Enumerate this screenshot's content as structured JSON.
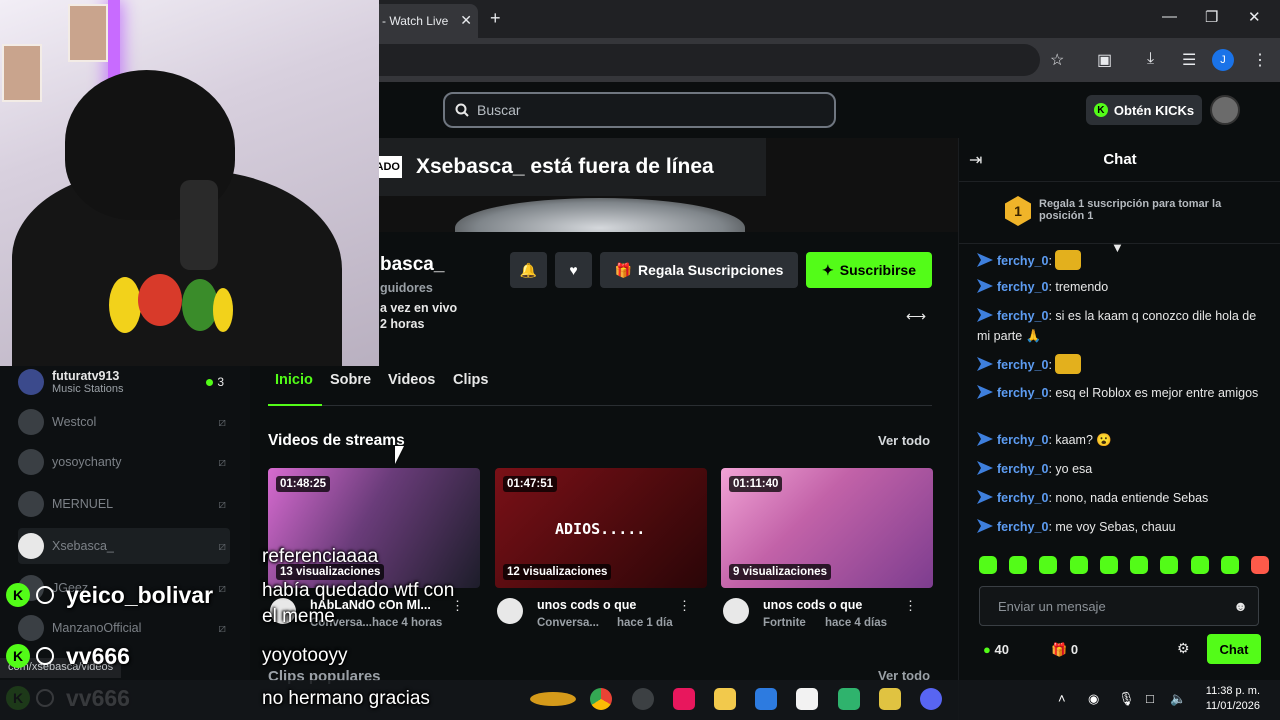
{
  "browser": {
    "tab_title": " - Watch Live",
    "tab_close": "✕",
    "new_tab": "+",
    "profile_initial": "J"
  },
  "topnav": {
    "search_placeholder": "Buscar",
    "kicks_button": "Obtén KICKs"
  },
  "sidebar": {
    "items": [
      {
        "name": "futuratv913",
        "sub": "Music Stations",
        "viewers": "3",
        "live": true
      },
      {
        "name": "Westcol"
      },
      {
        "name": "yosoychanty"
      },
      {
        "name": "MERNUEL"
      },
      {
        "name": "Xsebasca_"
      },
      {
        "name": "JGeez"
      },
      {
        "name": "ManzanoOfficial"
      }
    ]
  },
  "channel": {
    "offline_tag": "ADO",
    "offline_title": "Xsebasca_ está fuera de línea",
    "name": "basca_",
    "followers": "guidores",
    "last_live_line1": "a vez en vivo",
    "last_live_line2": "2 horas",
    "gift_subs": "Regala Suscripciones",
    "subscribe": "Suscribirse"
  },
  "tabs": [
    "Inicio",
    "Sobre",
    "Videos",
    "Clips"
  ],
  "videos": {
    "title": "Videos de streams",
    "see_all": "Ver todo",
    "items": [
      {
        "duration": "01:48:25",
        "views": "13 visualizaciones",
        "title": "hAbLaNdO cOn Ml...",
        "category": "Conversa...",
        "age": "hace 4 horas",
        "thumb": "#5b3f6e"
      },
      {
        "duration": "01:47:51",
        "views": "12 visualizaciones",
        "title": "unos cods o que",
        "category": "Conversa...",
        "age": "hace 1 día",
        "thumb": "#6e0f14",
        "overlay_text": "ADIOS....."
      },
      {
        "duration": "01:11:40",
        "views": "9 visualizaciones",
        "title": "unos cods o que",
        "category": "Fortnite",
        "age": "hace 4 días",
        "thumb": "#c262a8"
      }
    ]
  },
  "clips": {
    "title": "Clips populares",
    "see_all": "Ver todo"
  },
  "status_url": "com/xsebasca/videos",
  "chat": {
    "title": "Chat",
    "gift_rank": "1",
    "gift_prompt": "Regala 1 suscripción para tomar la posición 1",
    "messages": [
      {
        "user": "ferchy_0",
        "text": "",
        "emote": true
      },
      {
        "user": "ferchy_0",
        "text": "tremendo"
      },
      {
        "user": "ferchy_0",
        "text": "si es la kaam q conozco dile hola de mi parte 🙏"
      },
      {
        "user": "ferchy_0",
        "text": "",
        "emote": true
      },
      {
        "user": "ferchy_0",
        "text": "esq el Roblox es mejor entre amigos"
      },
      {
        "user": "ferchy_0",
        "text": "kaam? 😮"
      },
      {
        "user": "ferchy_0",
        "text": "yo esa"
      },
      {
        "user": "ferchy_0",
        "text": "nono, nada entiende Sebas"
      },
      {
        "user": "ferchy_0",
        "text": "me voy Sebas, chauu"
      }
    ],
    "input_placeholder": "Enviar un mensaje",
    "kicks_balance": "40",
    "gift_balance": "0",
    "send_button": "Chat"
  },
  "overlay": {
    "chat_lines": [
      {
        "user": "yeico_bolivar"
      },
      {
        "user": "vv666"
      },
      {
        "user": "vv666"
      }
    ],
    "subtitles": [
      "referenciaaaa",
      "había quedado wtf con",
      "el meme",
      "yoyotooyy",
      "no hermano gracias"
    ]
  },
  "taskbar": {
    "time": "11:38 p. m.",
    "date": "11/01/2026"
  },
  "colors": {
    "kick_green": "#53fc18",
    "chat_username": "#5d9cf2",
    "background": "#0b0e0f"
  }
}
